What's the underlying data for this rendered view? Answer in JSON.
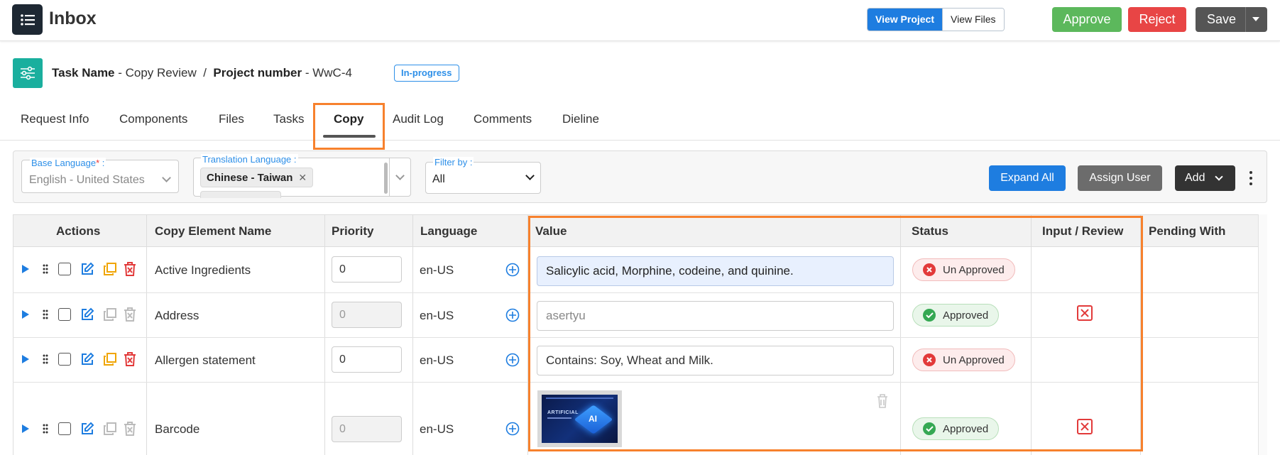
{
  "header": {
    "title": "Inbox",
    "view_project": "View Project",
    "view_files": "View Files",
    "approve": "Approve",
    "reject": "Reject",
    "save": "Save"
  },
  "task": {
    "task_name_label": "Task Name",
    "task_name": "Copy Review",
    "separator": "/",
    "project_label": "Project number",
    "project_number": "WwC-4",
    "status": "In-progress"
  },
  "tabs": [
    "Request Info",
    "Components",
    "Files",
    "Tasks",
    "Copy",
    "Audit Log",
    "Comments",
    "Dieline"
  ],
  "active_tab": "Copy",
  "filters": {
    "base_language_label": "Base Language",
    "base_language_required": "*",
    "base_language_value": "English - United States",
    "translation_language_label": "Translation Language :",
    "translation_chip": "Chinese - Taiwan",
    "filter_by_label": "Filter by :",
    "filter_by_value": "All",
    "expand_all": "Expand All",
    "assign_user": "Assign User",
    "add": "Add"
  },
  "table": {
    "columns": [
      "Actions",
      "Copy Element Name",
      "Priority",
      "Language",
      "Value",
      "Status",
      "Input / Review",
      "Pending With"
    ],
    "rows": [
      {
        "name": "Active Ingredients",
        "priority": "0",
        "priority_disabled": false,
        "language": "en-US",
        "value": "Salicylic acid, Morphine, codeine, and quinine.",
        "status": "Un Approved"
      },
      {
        "name": "Address",
        "priority": "0",
        "priority_disabled": true,
        "language": "en-US",
        "value": "asertyu",
        "status": "Approved"
      },
      {
        "name": "Allergen statement",
        "priority": "0",
        "priority_disabled": false,
        "language": "en-US",
        "value": "Contains: Soy, Wheat and Milk.",
        "status": "Un Approved"
      },
      {
        "name": "Barcode",
        "priority": "0",
        "priority_disabled": true,
        "language": "en-US",
        "value": "",
        "status": "Approved"
      }
    ]
  },
  "thumbnail_text": {
    "line1": "ARTIFICIAL",
    "badge": "AI"
  },
  "colors": {
    "accent": "#1e7de0",
    "highlight": "#f7812d",
    "approve": "#5cb85c",
    "reject": "#e84545",
    "teal": "#1aaf9e"
  }
}
